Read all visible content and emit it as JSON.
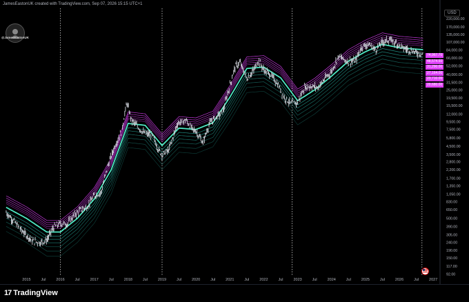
{
  "header": {
    "credit": "JamesEastonUK created with TradingView.com, Sep 07, 2026 15:15 UTC+1"
  },
  "avatar": {
    "name": "@JamesEastonUK"
  },
  "axis": {
    "currency": "USD"
  },
  "footer": {
    "brand": "TradingView"
  },
  "price_tags": [
    {
      "label": "74,967.70",
      "color": "#ffffff",
      "bg": "#e040fb"
    },
    {
      "label": "48,574.50",
      "color": "#ffffff",
      "bg": "#e040fb"
    },
    {
      "label": "31,290.00",
      "color": "#ffffff",
      "bg": "#e040fb"
    },
    {
      "label": "27,164.00",
      "color": "#ffffff",
      "bg": "#e040fb"
    },
    {
      "label": "23,710.00",
      "color": "#ffffff",
      "bg": "#e040fb"
    },
    {
      "label": "20,680.00",
      "color": "#ffffff",
      "bg": "#e040fb"
    }
  ],
  "colors": {
    "background": "#000000",
    "candle": "#d1d4dc",
    "upper_bands": "#e040fb",
    "lower_bands": "#26a69a",
    "core": "#4ee8c4",
    "grid_vline": "#cccccc"
  },
  "chart_data": {
    "type": "line",
    "title": "",
    "xlabel": "",
    "ylabel": "",
    "y_scale": "log",
    "x_ticks": [
      "2015",
      "Jul",
      "2016",
      "Jul",
      "2017",
      "Jul",
      "2018",
      "Jul",
      "2019",
      "Jul",
      "2020",
      "Jul",
      "2021",
      "Jul",
      "2022",
      "Jul",
      "2023",
      "Jul",
      "2024",
      "Jul",
      "2025",
      "Jul",
      "2026",
      "Jul",
      "2027"
    ],
    "y_ticks": [
      220000,
      170000,
      135000,
      107000,
      84000,
      66000,
      52000,
      40000,
      31500,
      25000,
      19500,
      15500,
      12000,
      9500,
      7500,
      5800,
      4500,
      3500,
      2800,
      2200,
      1700,
      1350,
      1050,
      830,
      650,
      500,
      390,
      305,
      240,
      190,
      150,
      117,
      92
    ],
    "y_tick_labels": [
      "220,000.00",
      "170,000.00",
      "135,000.00",
      "107,000.00",
      "84,000.00",
      "66,000.00",
      "52,000.00",
      "40,000.00",
      "31,500.00",
      "25,000.00",
      "19,500.00",
      "15,500.00",
      "12,000.00",
      "9,500.00",
      "7,500.00",
      "5,800.00",
      "4,500.00",
      "3,500.00",
      "2,800.00",
      "2,200.00",
      "1,700.00",
      "1,350.00",
      "1,050.00",
      "830.00",
      "650.00",
      "500.00",
      "390.00",
      "305.00",
      "240.00",
      "190.00",
      "150.00",
      "117.00",
      "92.00"
    ],
    "ylim": [
      80,
      300000
    ],
    "vertical_markers": [
      "2016-01",
      "2019-01",
      "2022-11",
      "2026-09"
    ],
    "series": [
      {
        "kind": "price",
        "x": [
          2014.4,
          2014.6,
          2014.8,
          2015.0,
          2015.2,
          2015.4,
          2015.6,
          2015.8,
          2016.0,
          2016.2,
          2016.4,
          2016.6,
          2016.8,
          2017.0,
          2017.2,
          2017.4,
          2017.6,
          2017.8,
          2017.96,
          2018.1,
          2018.3,
          2018.5,
          2018.7,
          2018.9,
          2019.0,
          2019.2,
          2019.45,
          2019.7,
          2019.9,
          2020.0,
          2020.2,
          2020.4,
          2020.6,
          2020.8,
          2021.0,
          2021.15,
          2021.3,
          2021.5,
          2021.7,
          2021.85,
          2022.0,
          2022.2,
          2022.45,
          2022.6,
          2022.8,
          2023.0,
          2023.2,
          2023.4,
          2023.6,
          2023.8,
          2024.0,
          2024.2,
          2024.45,
          2024.7,
          2024.9,
          2025.1,
          2025.3,
          2025.5,
          2025.7,
          2025.9,
          2026.1,
          2026.3,
          2026.5,
          2026.7
        ],
        "values": [
          600,
          480,
          370,
          300,
          250,
          240,
          260,
          380,
          430,
          420,
          550,
          650,
          720,
          1000,
          1100,
          2500,
          4500,
          7000,
          17000,
          10000,
          8000,
          6500,
          6500,
          4000,
          3500,
          4000,
          9000,
          10000,
          7500,
          7200,
          5000,
          9000,
          11000,
          13000,
          29000,
          50000,
          58000,
          35000,
          45000,
          62000,
          46000,
          40000,
          28000,
          20000,
          16500,
          17000,
          27000,
          28000,
          27000,
          35000,
          44000,
          70000,
          60000,
          60000,
          95000,
          100000,
          85000,
          108000,
          115000,
          105000,
          90000,
          85000,
          78000,
          75000
        ]
      },
      {
        "kind": "core",
        "x": [
          2014.4,
          2015.0,
          2015.6,
          2016.0,
          2016.5,
          2017.0,
          2017.5,
          2018.0,
          2018.5,
          2019.0,
          2019.5,
          2020.0,
          2020.5,
          2021.0,
          2021.5,
          2022.0,
          2022.5,
          2023.0,
          2023.5,
          2024.0,
          2024.5,
          2025.0,
          2025.5,
          2026.0,
          2026.7
        ],
        "values": [
          700,
          500,
          330,
          330,
          500,
          900,
          2200,
          9000,
          8500,
          4600,
          7800,
          7500,
          9200,
          20000,
          48000,
          50000,
          36000,
          18000,
          25000,
          38000,
          60000,
          80000,
          100000,
          90000,
          85000
        ]
      }
    ]
  }
}
